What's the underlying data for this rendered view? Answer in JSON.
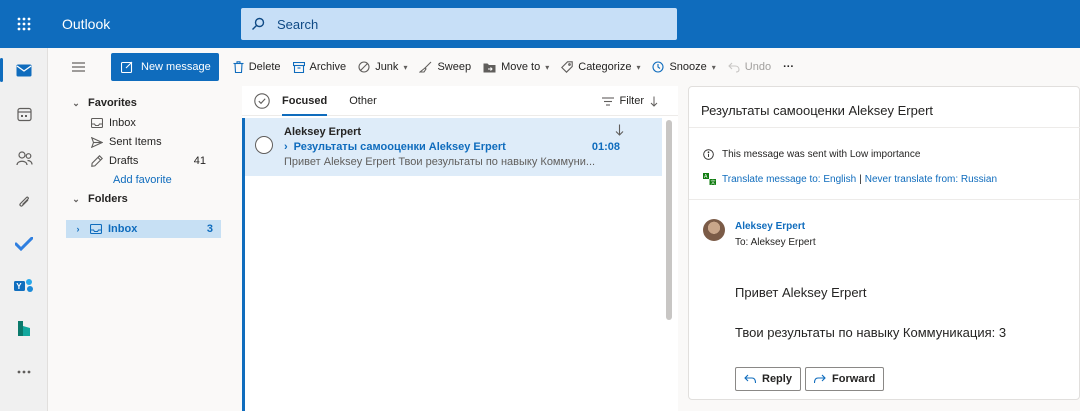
{
  "topbar": {
    "app_name": "Outlook",
    "search_placeholder": "Search"
  },
  "toolbar": {
    "new_message": "New message",
    "delete": "Delete",
    "archive": "Archive",
    "junk": "Junk",
    "sweep": "Sweep",
    "move_to": "Move to",
    "categorize": "Categorize",
    "snooze": "Snooze",
    "undo": "Undo",
    "more": "···"
  },
  "folders": {
    "favorites_header": "Favorites",
    "favorites": [
      {
        "label": "Inbox",
        "count": ""
      },
      {
        "label": "Sent Items",
        "count": ""
      },
      {
        "label": "Drafts",
        "count": "41"
      }
    ],
    "add_favorite": "Add favorite",
    "folders_header": "Folders",
    "inbox": {
      "label": "Inbox",
      "count": "3"
    }
  },
  "list": {
    "tabs": [
      {
        "label": "Focused",
        "active": true
      },
      {
        "label": "Other",
        "active": false
      }
    ],
    "filter_label": "Filter",
    "messages": [
      {
        "sender": "Aleksey Erpert",
        "subject": "Результаты самооценки Aleksey Erpert",
        "time": "01:08",
        "preview": "Привет Aleksey Erpert Твои результаты по навыку Коммуни..."
      }
    ]
  },
  "reading": {
    "subject": "Результаты самооценки Aleksey Erpert",
    "importance_note": "This message was sent with Low importance",
    "translate_link": "Translate message to: English",
    "translate_sep": "|",
    "never_translate_link": "Never translate from: Russian",
    "from_name": "Aleksey Erpert",
    "to_line": "To:  Aleksey Erpert",
    "body_line1": "Привет Aleksey Erpert",
    "body_line2": "Твои результаты по навыку Коммуникация: 3",
    "reply": "Reply",
    "forward": "Forward"
  },
  "colors": {
    "brand": "#0f6cbd",
    "selected_item": "#deecf9"
  }
}
